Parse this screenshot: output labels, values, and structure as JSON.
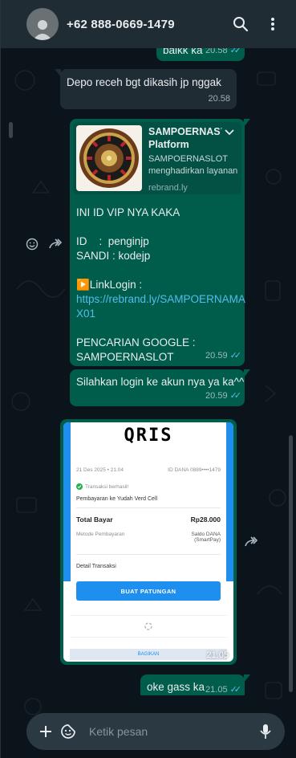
{
  "header": {
    "contact": "+62 888-0669-1479"
  },
  "messages": {
    "m0": {
      "text": "baikk ka",
      "time": "20.58"
    },
    "m1": {
      "text": "Depo receh bgt dikasih jp nggak",
      "time": "20.58"
    },
    "m2": {
      "preview": {
        "title": "SAMPOERNASLOT Platform Hiburan…",
        "description": "SAMPOERNASLOT menghadirkan layanan",
        "domain": "rebrand.ly"
      },
      "lines": [
        "INI ID VIP NYA KAKA",
        "",
        "ID    :  penginjp",
        "SANDI : kodejp",
        "",
        "▶️LinkLogin :",
        "https://rebrand.ly/SAMPOERNAMA",
        "X01",
        "",
        "PENCARIAN GOOGLE :",
        "SAMPOERNASLOT"
      ],
      "time": "20.59"
    },
    "m3": {
      "text": "Silahkan login ke akun nya ya ka^^",
      "time": "20.59"
    },
    "m4": {
      "receipt": {
        "logo": "QRIS",
        "date": "21 Des 2025 • 21.04",
        "dana_id": "ID DANA 0889••••1479",
        "status": "Transaksi berhasil!",
        "payee": "Pembayaran ke Yudah Verd Cell",
        "total_label": "Total Bayar",
        "total_value": "Rp28.000",
        "method_label": "Metode Pembayaran",
        "method_value": "Saldo DANA\n(SmartPay)",
        "detail_label": "Detail Transaksi",
        "cta": "BUAT PATUNGAN",
        "share": "BAGIKAN"
      },
      "time": "21.05"
    },
    "m5": {
      "text": "oke gass ka",
      "time": "21.05"
    }
  },
  "composer": {
    "placeholder": "Ketik pesan"
  },
  "colors": {
    "background": "#0b141a",
    "header": "#202c33",
    "incoming": "#202c33",
    "outgoing": "#005c4b",
    "link": "#53bdeb",
    "read_ticks": "#53bdeb",
    "dana_blue": "#1e8fef"
  },
  "icons": [
    "person-icon",
    "search-icon",
    "kebab-menu-icon",
    "emoji-react-icon",
    "forward-icon",
    "chevron-down-icon",
    "plus-icon",
    "sticker-icon",
    "mic-icon"
  ]
}
